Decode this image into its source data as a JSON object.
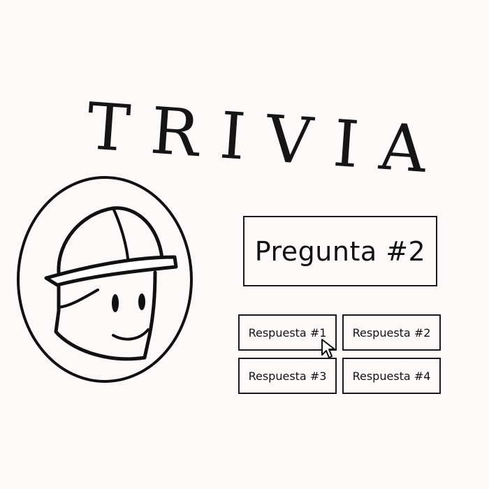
{
  "title": "TRIVIA",
  "question": {
    "label": "Pregunta #2"
  },
  "answers": [
    {
      "label": "Respuesta #1"
    },
    {
      "label": "Respuesta #2"
    },
    {
      "label": "Respuesta #3"
    },
    {
      "label": "Respuesta #4"
    }
  ],
  "icons": {
    "mascot": "helmet-character-icon",
    "pointer": "mouse-cursor-icon"
  },
  "colors": {
    "background": "#fdf9f9",
    "ink": "#111111"
  }
}
